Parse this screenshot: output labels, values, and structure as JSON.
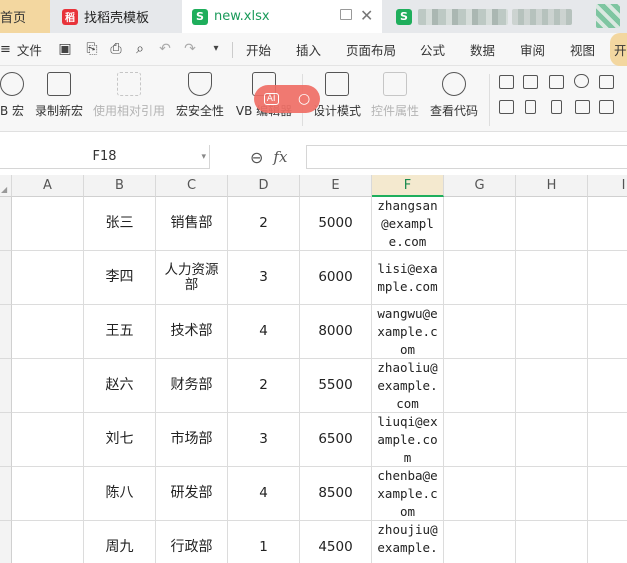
{
  "tabs": [
    {
      "label": "首页"
    },
    {
      "label": "找稻壳模板"
    },
    {
      "label": "new.xlsx"
    }
  ],
  "menu": {
    "file_label": "文件",
    "items": [
      "开始",
      "插入",
      "页面布局",
      "公式",
      "数据",
      "审阅",
      "视图",
      "开"
    ]
  },
  "toolbar": {
    "items": [
      {
        "label": "B 宏",
        "disabled": false
      },
      {
        "label": "录制新宏",
        "disabled": false
      },
      {
        "label": "使用相对引用",
        "disabled": true
      },
      {
        "label": "宏安全性",
        "disabled": false
      },
      {
        "label": "VB 编辑器",
        "disabled": false
      },
      {
        "label": "设计模式",
        "disabled": false
      },
      {
        "label": "控件属性",
        "disabled": true
      },
      {
        "label": "查看代码",
        "disabled": false
      }
    ],
    "ai_label": "AI"
  },
  "formula_bar": {
    "name_box": "F18",
    "fx_label": "fx",
    "formula": ""
  },
  "sheet": {
    "columns": [
      "A",
      "B",
      "C",
      "D",
      "E",
      "F",
      "G",
      "H",
      "I"
    ],
    "active_column": "F",
    "rows": [
      {
        "name": "张三",
        "dept": "销售部",
        "level": "2",
        "salary": "5000",
        "email": "zhangsan@example.com"
      },
      {
        "name": "李四",
        "dept": "人力资源部",
        "level": "3",
        "salary": "6000",
        "email": "lisi@example.com"
      },
      {
        "name": "王五",
        "dept": "技术部",
        "level": "4",
        "salary": "8000",
        "email": "wangwu@example.com"
      },
      {
        "name": "赵六",
        "dept": "财务部",
        "level": "2",
        "salary": "5500",
        "email": "zhaoliu@example.com"
      },
      {
        "name": "刘七",
        "dept": "市场部",
        "level": "3",
        "salary": "6500",
        "email": "liuqi@example.com"
      },
      {
        "name": "陈八",
        "dept": "研发部",
        "level": "4",
        "salary": "8500",
        "email": "chenba@example.com"
      },
      {
        "name": "周九",
        "dept": "行政部",
        "level": "1",
        "salary": "4500",
        "email": "zhoujiu@example.com"
      }
    ]
  },
  "colors": {
    "accent_green": "#1fae5c",
    "home_tab": "#f3d7a0",
    "template_icon": "#e8333a",
    "ai_badge": "#f06f66"
  }
}
